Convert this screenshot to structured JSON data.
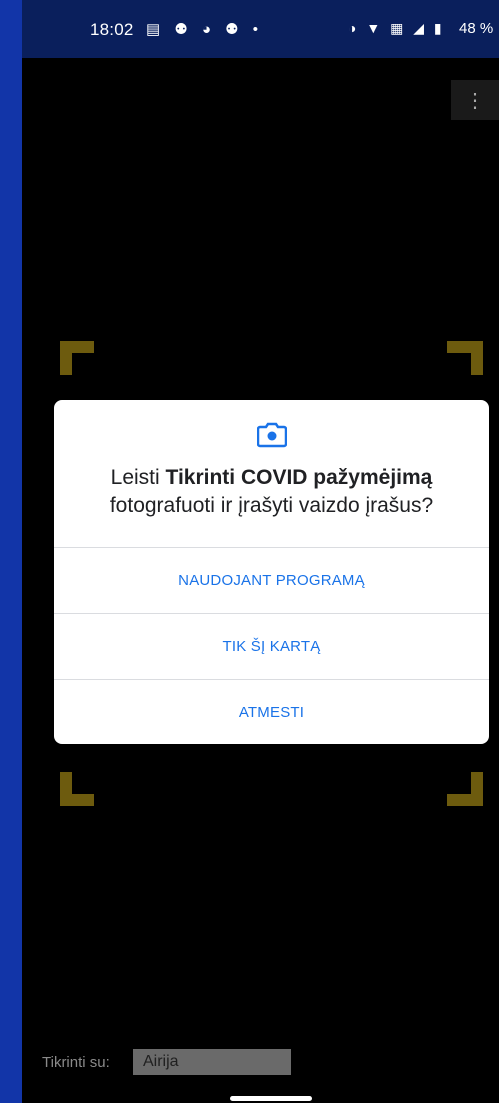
{
  "status_bar": {
    "time": "18:02",
    "notification_icons": "▤ ⚉ ◕ ⚉ •",
    "system_icons": "◑ ▼ ▦ ◢ ▮",
    "battery": "48 %"
  },
  "overflow_menu": {
    "icon": "⋮"
  },
  "dialog": {
    "title_prefix": "Leisti ",
    "title_app": "Tikrinti COVID pažymėjimą",
    "title_line2": "fotografuoti ir įrašyti vaizdo įrašus?",
    "buttons": [
      {
        "label": "NAUDOJANT PROGRAMĄ"
      },
      {
        "label": "TIK ŠĮ KARTĄ"
      },
      {
        "label": "ATMESTI"
      }
    ],
    "accent_color": "#1a73e8"
  },
  "footer": {
    "label": "Tikrinti su:",
    "selected_value": "Airija"
  },
  "colors": {
    "frame_background": "#0b2d8f",
    "scanner_corner": "#6d5b0e",
    "camera_background": "#000000"
  }
}
